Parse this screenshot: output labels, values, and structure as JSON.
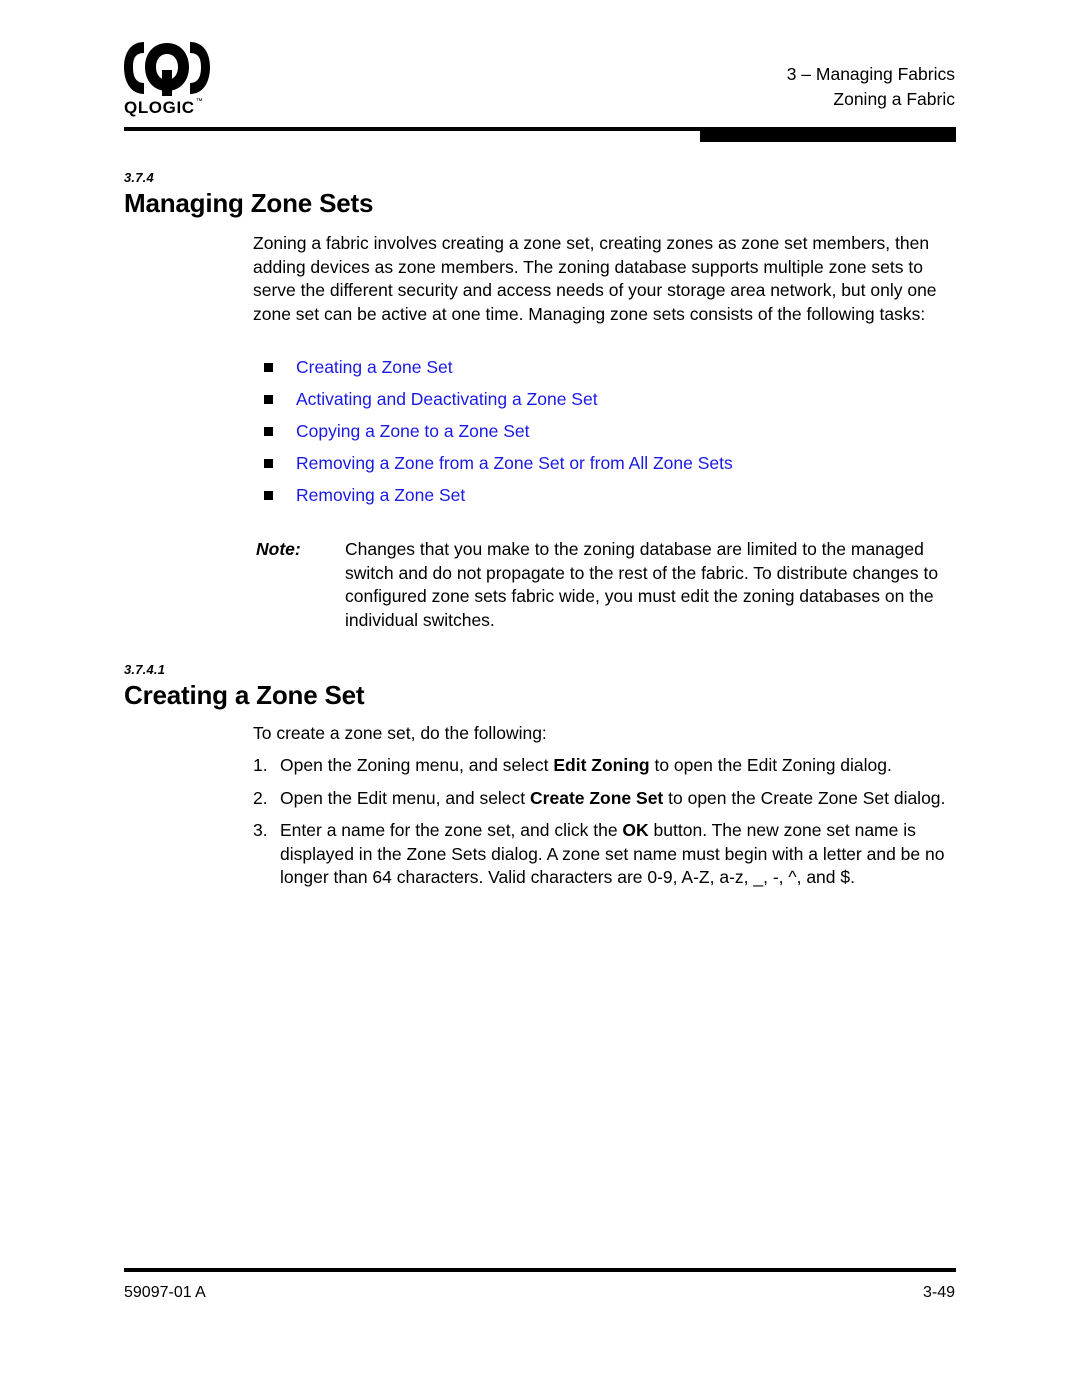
{
  "document": {
    "logo": {
      "wordmark": "QLOGIC",
      "trademark": "™"
    },
    "header": {
      "chapter_line": "3 – Managing Fabrics",
      "section_line": "Zoning a Fabric"
    },
    "footer": {
      "doc_number": "59097-01 A",
      "page_number": "3-49"
    }
  },
  "sections": [
    {
      "number": "3.7.4",
      "title": "Managing Zone Sets"
    },
    {
      "number": "3.7.4.1",
      "title": "Creating a Zone Set"
    }
  ],
  "body": {
    "intro_paragraph": "Zoning a fabric involves creating a zone set, creating zones as zone set members, then adding devices as zone members. The zoning database supports multiple zone sets to serve the different security and access needs of your storage area network, but only one zone set can be active at one time. Managing zone sets consists of the following tasks:",
    "to_do_paragraph": "To create a zone set, do the following:"
  },
  "task_links": [
    {
      "label": "Creating a Zone Set"
    },
    {
      "label": "Activating and Deactivating a Zone Set"
    },
    {
      "label": "Copying a Zone to a Zone Set"
    },
    {
      "label": "Removing a Zone from a Zone Set or from All Zone Sets"
    },
    {
      "label": "Removing a Zone Set"
    }
  ],
  "note": {
    "label": "Note:",
    "text": "Changes that you make to the zoning database are limited to the managed switch and do not propagate to the rest of the fabric. To distribute changes to configured zone sets fabric wide, you must edit the zoning databases on the individual switches."
  },
  "steps": [
    {
      "number": "1.",
      "parts": [
        {
          "text": "Open the Zoning menu, and select ",
          "bold": false
        },
        {
          "text": "Edit Zoning",
          "bold": true
        },
        {
          "text": " to open the Edit Zoning dialog.",
          "bold": false
        }
      ]
    },
    {
      "number": "2.",
      "parts": [
        {
          "text": "Open the Edit menu, and select ",
          "bold": false
        },
        {
          "text": "Create Zone Set",
          "bold": true
        },
        {
          "text": " to open the Create Zone Set dialog.",
          "bold": false
        }
      ]
    },
    {
      "number": "3.",
      "parts": [
        {
          "text": "Enter a name for the zone set, and click the ",
          "bold": false
        },
        {
          "text": "OK",
          "bold": true
        },
        {
          "text": " button. The new zone set name is displayed in the Zone Sets dialog. A zone set name must begin with a letter and be no longer than 64 characters. Valid characters are 0-9, A-Z, a-z, _, -, ^, and $.",
          "bold": false
        }
      ]
    }
  ],
  "colors": {
    "link": "#1A1AE6",
    "text": "#000000",
    "rule": "#000000",
    "background": "#FFFFFF"
  }
}
